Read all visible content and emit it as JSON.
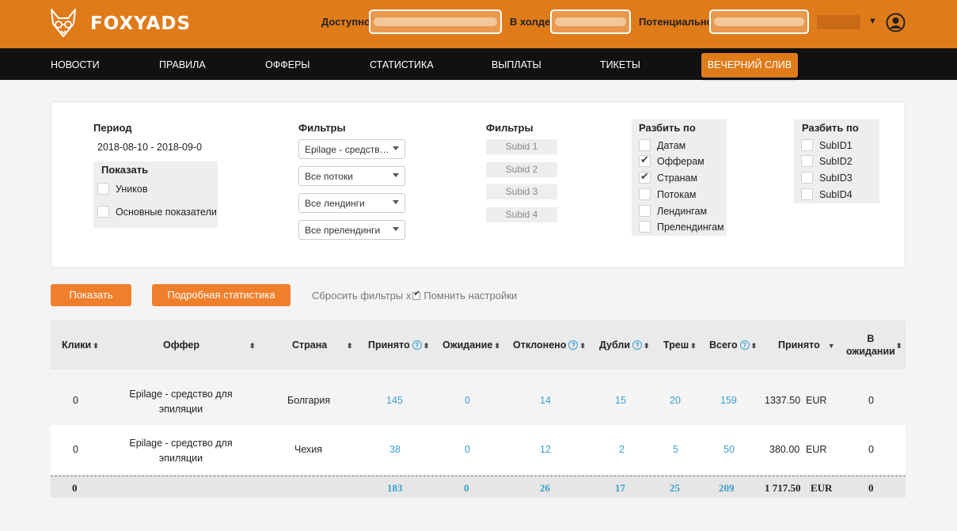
{
  "header": {
    "brand": "FOXYADS",
    "balances": [
      {
        "label": "Доступно"
      },
      {
        "label": "В холде"
      },
      {
        "label": "Потенциально"
      }
    ]
  },
  "nav": {
    "items": [
      "НОВОСТИ",
      "ПРАВИЛА",
      "ОФФЕРЫ",
      "СТАТИСТИКА",
      "ВЫПЛАТЫ",
      "ТИКЕТЫ"
    ],
    "special": "ВЕЧЕРНИЙ СЛИВ"
  },
  "filters": {
    "period_label": "Период",
    "period_value": "2018-08-10 - 2018-09-0",
    "show_label": "Показать",
    "show_options": [
      {
        "label": "Уников",
        "checked": false
      },
      {
        "label": "Основные показатели",
        "checked": false
      }
    ],
    "filters_label": "Фильтры",
    "selects": [
      "Epilage - средств…",
      "Все потоки",
      "Все лендинги",
      "Все прелендинги"
    ],
    "filters2_label": "Фильтры",
    "subids": [
      "Subid 1",
      "Subid 2",
      "Subid 3",
      "Subid 4"
    ],
    "split_label": "Разбить по",
    "split_options": [
      {
        "label": "Датам",
        "checked": false
      },
      {
        "label": "Офферам",
        "checked": true
      },
      {
        "label": "Странам",
        "checked": true
      },
      {
        "label": "Потокам",
        "checked": false
      },
      {
        "label": "Лендингам",
        "checked": false
      },
      {
        "label": "Прелендингам",
        "checked": false
      }
    ],
    "split2_label": "Разбить по",
    "split2_options": [
      {
        "label": "SubID1",
        "checked": false
      },
      {
        "label": "SubID2",
        "checked": false
      },
      {
        "label": "SubID3",
        "checked": false
      },
      {
        "label": "SubID4",
        "checked": false
      }
    ]
  },
  "actions": {
    "show_button": "Показать",
    "detailed_button": "Подробная статистика",
    "reset_text": "Сбросить фильтры x",
    "remember_text": "Помнить настройки"
  },
  "table": {
    "headers": {
      "clicks": "Клики",
      "offer": "Оффер",
      "country": "Страна",
      "accepted": "Принято",
      "pending": "Ожидание",
      "rejected": "Отклонено",
      "duplicates": "Дубли",
      "trash": "Треш",
      "total": "Всего",
      "accepted_sum": "Принято",
      "in_pending_1": "В",
      "in_pending_2": "ожидании"
    },
    "rows": [
      {
        "clicks": "0",
        "offer_1": "Epilage - средство для",
        "offer_2": "эпиляции",
        "country": "Болгария",
        "accepted": "145",
        "pending": "0",
        "rejected": "14",
        "duplicates": "15",
        "trash": "20",
        "total": "159",
        "sum": "1337.50",
        "currency": "EUR",
        "in_pending": "0"
      },
      {
        "clicks": "0",
        "offer_1": "Epilage - средство для",
        "offer_2": "эпиляции",
        "country": "Чехия",
        "accepted": "38",
        "pending": "0",
        "rejected": "12",
        "duplicates": "2",
        "trash": "5",
        "total": "50",
        "sum": "380.00",
        "currency": "EUR",
        "in_pending": "0"
      }
    ],
    "totals": {
      "clicks": "0",
      "accepted": "183",
      "pending": "0",
      "rejected": "26",
      "duplicates": "17",
      "trash": "25",
      "total": "209",
      "sum": "1 717.50",
      "currency": "EUR",
      "in_pending": "0"
    }
  },
  "colors": {
    "brand_orange": "#e07b1a",
    "button_orange": "#f07f2c",
    "nav_black": "#111111",
    "link_blue": "#3a9fd1"
  }
}
